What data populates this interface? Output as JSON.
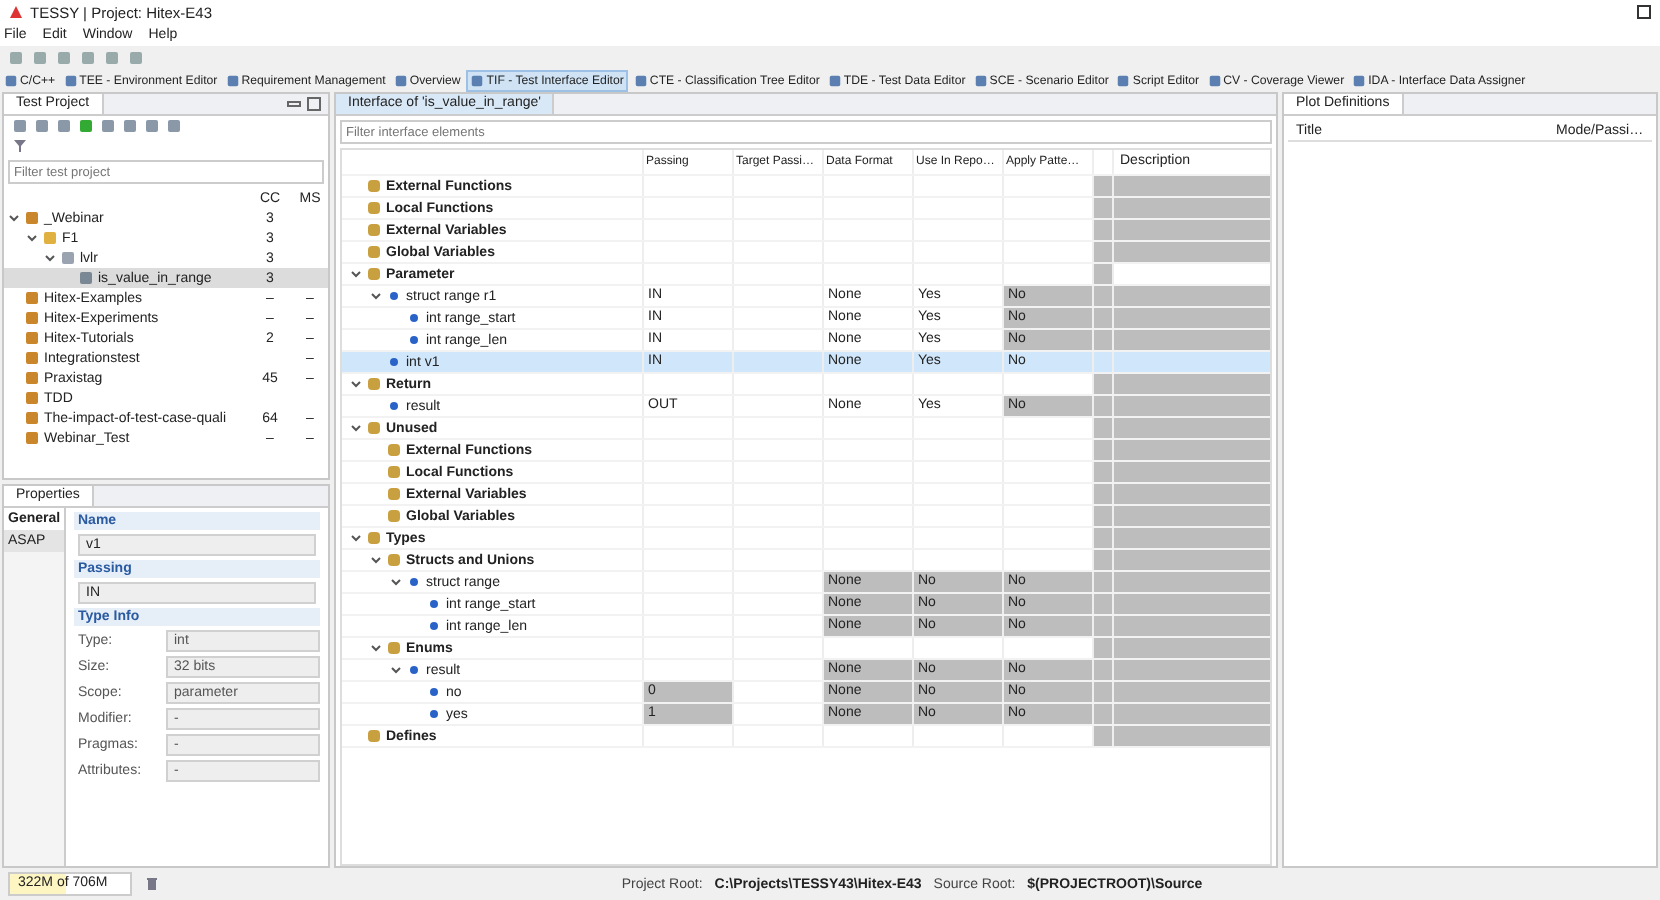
{
  "window": {
    "title": "TESSY | Project: Hitex-E43"
  },
  "menu": [
    "File",
    "Edit",
    "Window",
    "Help"
  ],
  "perspectives": [
    {
      "label": "C/C++",
      "selected": false
    },
    {
      "label": "TEE - Environment Editor",
      "selected": false
    },
    {
      "label": "Requirement Management",
      "selected": false
    },
    {
      "label": "Overview",
      "selected": false
    },
    {
      "label": "TIF - Test Interface Editor",
      "selected": true
    },
    {
      "label": "CTE - Classification Tree Editor",
      "selected": false
    },
    {
      "label": "TDE - Test Data Editor",
      "selected": false
    },
    {
      "label": "SCE - Scenario Editor",
      "selected": false
    },
    {
      "label": "Script Editor",
      "selected": false
    },
    {
      "label": "CV - Coverage Viewer",
      "selected": false
    },
    {
      "label": "IDA - Interface Data Assigner",
      "selected": false
    }
  ],
  "test_project": {
    "title": "Test Project",
    "filter_placeholder": "Filter test project",
    "columns": [
      "CC",
      "MS"
    ],
    "items": [
      {
        "label": "_Webinar",
        "kind": "project",
        "cc": "3",
        "selected": false,
        "expanded": true,
        "children": [
          {
            "label": "F1",
            "kind": "folder",
            "cc": "3",
            "selected": false,
            "expanded": true,
            "children": [
              {
                "label": "lvlr",
                "kind": "module",
                "cc": "3",
                "selected": false,
                "expanded": true,
                "children": [
                  {
                    "label": "is_value_in_range",
                    "kind": "test_object",
                    "cc": "3",
                    "selected": true
                  }
                ]
              }
            ]
          }
        ]
      },
      {
        "label": "Hitex-Examples",
        "kind": "project",
        "cc": "–",
        "ms": "–",
        "selected": false
      },
      {
        "label": "Hitex-Experiments",
        "kind": "project",
        "cc": "–",
        "ms": "–",
        "selected": false
      },
      {
        "label": "Hitex-Tutorials",
        "kind": "project",
        "cc": "2",
        "ms": "–",
        "selected": false
      },
      {
        "label": "Integrationstest",
        "kind": "project",
        "ms": "–",
        "selected": false
      },
      {
        "label": "Praxistag",
        "kind": "project",
        "cc": "45",
        "ms": "–",
        "selected": false
      },
      {
        "label": "TDD",
        "kind": "project",
        "selected": false
      },
      {
        "label": "The-impact-of-test-case-quali",
        "kind": "project",
        "cc": "64",
        "ms": "–",
        "selected": false
      },
      {
        "label": "Webinar_Test",
        "kind": "project",
        "cc": "–",
        "ms": "–",
        "selected": false
      }
    ]
  },
  "properties": {
    "title": "Properties",
    "tabs": [
      {
        "label": "General",
        "selected": true
      },
      {
        "label": "ASAP",
        "selected": false
      }
    ],
    "name": {
      "heading": "Name",
      "value": "v1"
    },
    "passing": {
      "heading": "Passing",
      "value": "IN"
    },
    "type_info": {
      "heading": "Type Info",
      "fields": [
        {
          "label": "Type:",
          "value": "int"
        },
        {
          "label": "Size:",
          "value": "32 bits"
        },
        {
          "label": "Scope:",
          "value": "parameter"
        },
        {
          "label": "Modifier:",
          "value": "-"
        },
        {
          "label": "Pragmas:",
          "value": "-"
        },
        {
          "label": "Attributes:",
          "value": "-"
        }
      ]
    }
  },
  "interface": {
    "title": "Interface of 'is_value_in_range'",
    "filter_placeholder": "Filter interface elements",
    "columns": [
      "Passing",
      "Target Passi…",
      "Data Format",
      "Use In Repo…",
      "Apply Patte…",
      "Description"
    ],
    "rows": [
      {
        "label": "External Functions",
        "kind": "category",
        "selected": false,
        "cells": [
          {
            "greyed": false
          },
          {
            "greyed": false
          },
          {
            "greyed": false
          },
          {
            "greyed": false
          },
          {
            "greyed": false
          },
          {
            "greyed": true
          },
          {
            "greyed": true
          }
        ]
      },
      {
        "label": "Local Functions",
        "kind": "category",
        "selected": false,
        "cells": [
          {
            "greyed": false
          },
          {
            "greyed": false
          },
          {
            "greyed": false
          },
          {
            "greyed": false
          },
          {
            "greyed": false
          },
          {
            "greyed": true
          },
          {
            "greyed": true
          }
        ]
      },
      {
        "label": "External Variables",
        "kind": "category",
        "selected": false,
        "cells": [
          {
            "greyed": false
          },
          {
            "greyed": false
          },
          {
            "greyed": false
          },
          {
            "greyed": false
          },
          {
            "greyed": false
          },
          {
            "greyed": true
          },
          {
            "greyed": true
          }
        ]
      },
      {
        "label": "Global Variables",
        "kind": "category",
        "selected": false,
        "cells": [
          {
            "greyed": false
          },
          {
            "greyed": false
          },
          {
            "greyed": false
          },
          {
            "greyed": false
          },
          {
            "greyed": false
          },
          {
            "greyed": true
          },
          {
            "greyed": true
          }
        ]
      },
      {
        "label": "Parameter",
        "kind": "category",
        "selected": false,
        "expanded": true,
        "cells": [
          {
            "greyed": false
          },
          {
            "greyed": false
          },
          {
            "greyed": false
          },
          {
            "greyed": false
          },
          {
            "greyed": false
          },
          {
            "greyed": true
          },
          {
            "greyed": false
          }
        ],
        "children": [
          {
            "label": "struct range r1",
            "kind": "item",
            "selected": false,
            "expanded": true,
            "cells": [
              {
                "text": "IN",
                "greyed": false
              },
              {
                "greyed": false
              },
              {
                "text": "None",
                "greyed": false
              },
              {
                "text": "Yes",
                "greyed": false
              },
              {
                "text": "No",
                "greyed": true
              },
              {
                "greyed": true
              },
              {
                "greyed": true
              }
            ],
            "children": [
              {
                "label": "int range_start",
                "kind": "item",
                "selected": false,
                "cells": [
                  {
                    "text": "IN",
                    "greyed": false
                  },
                  {
                    "greyed": false
                  },
                  {
                    "text": "None",
                    "greyed": false
                  },
                  {
                    "text": "Yes",
                    "greyed": false
                  },
                  {
                    "text": "No",
                    "greyed": true
                  },
                  {
                    "greyed": true
                  },
                  {
                    "greyed": true
                  }
                ]
              },
              {
                "label": "int range_len",
                "kind": "item",
                "selected": false,
                "cells": [
                  {
                    "text": "IN",
                    "greyed": false
                  },
                  {
                    "greyed": false
                  },
                  {
                    "text": "None",
                    "greyed": false
                  },
                  {
                    "text": "Yes",
                    "greyed": false
                  },
                  {
                    "text": "No",
                    "greyed": true
                  },
                  {
                    "greyed": true
                  },
                  {
                    "greyed": true
                  }
                ]
              }
            ]
          },
          {
            "label": "int v1",
            "kind": "item",
            "selected": true,
            "cells": [
              {
                "text": "IN",
                "greyed": false
              },
              {
                "greyed": false
              },
              {
                "text": "None",
                "greyed": false
              },
              {
                "text": "Yes",
                "greyed": false
              },
              {
                "text": "No",
                "greyed": false
              },
              {
                "greyed": false
              },
              {
                "greyed": false
              }
            ]
          }
        ]
      },
      {
        "label": "Return",
        "kind": "category",
        "selected": false,
        "expanded": true,
        "cells": [
          {
            "greyed": false
          },
          {
            "greyed": false
          },
          {
            "greyed": false
          },
          {
            "greyed": false
          },
          {
            "greyed": false
          },
          {
            "greyed": true
          },
          {
            "greyed": true
          }
        ],
        "children": [
          {
            "label": "result",
            "kind": "item",
            "selected": false,
            "cells": [
              {
                "text": "OUT",
                "greyed": false
              },
              {
                "greyed": false
              },
              {
                "text": "None",
                "greyed": false
              },
              {
                "text": "Yes",
                "greyed": false
              },
              {
                "text": "No",
                "greyed": true
              },
              {
                "greyed": true
              },
              {
                "greyed": true
              }
            ]
          }
        ]
      },
      {
        "label": "Unused",
        "kind": "category",
        "selected": false,
        "expanded": true,
        "cells": [
          {
            "greyed": false
          },
          {
            "greyed": false
          },
          {
            "greyed": false
          },
          {
            "greyed": false
          },
          {
            "greyed": false
          },
          {
            "greyed": true
          },
          {
            "greyed": true
          }
        ],
        "children": [
          {
            "label": "External Functions",
            "kind": "category",
            "selected": false,
            "cells": [
              {
                "greyed": false
              },
              {
                "greyed": false
              },
              {
                "greyed": false
              },
              {
                "greyed": false
              },
              {
                "greyed": false
              },
              {
                "greyed": true
              },
              {
                "greyed": true
              }
            ]
          },
          {
            "label": "Local Functions",
            "kind": "category",
            "selected": false,
            "cells": [
              {
                "greyed": false
              },
              {
                "greyed": false
              },
              {
                "greyed": false
              },
              {
                "greyed": false
              },
              {
                "greyed": false
              },
              {
                "greyed": true
              },
              {
                "greyed": true
              }
            ]
          },
          {
            "label": "External Variables",
            "kind": "category",
            "selected": false,
            "cells": [
              {
                "greyed": false
              },
              {
                "greyed": false
              },
              {
                "greyed": false
              },
              {
                "greyed": false
              },
              {
                "greyed": false
              },
              {
                "greyed": true
              },
              {
                "greyed": true
              }
            ]
          },
          {
            "label": "Global Variables",
            "kind": "category",
            "selected": false,
            "cells": [
              {
                "greyed": false
              },
              {
                "greyed": false
              },
              {
                "greyed": false
              },
              {
                "greyed": false
              },
              {
                "greyed": false
              },
              {
                "greyed": true
              },
              {
                "greyed": true
              }
            ]
          }
        ]
      },
      {
        "label": "Types",
        "kind": "category",
        "selected": false,
        "expanded": true,
        "cells": [
          {
            "greyed": false
          },
          {
            "greyed": false
          },
          {
            "greyed": false
          },
          {
            "greyed": false
          },
          {
            "greyed": false
          },
          {
            "greyed": true
          },
          {
            "greyed": true
          }
        ],
        "children": [
          {
            "label": "Structs and Unions",
            "kind": "category",
            "selected": false,
            "expanded": true,
            "cells": [
              {
                "greyed": false
              },
              {
                "greyed": false
              },
              {
                "greyed": false
              },
              {
                "greyed": false
              },
              {
                "greyed": false
              },
              {
                "greyed": true
              },
              {
                "greyed": true
              }
            ],
            "children": [
              {
                "label": "struct range",
                "kind": "item",
                "selected": false,
                "expanded": true,
                "cells": [
                  {
                    "greyed": false
                  },
                  {
                    "greyed": false
                  },
                  {
                    "text": "None",
                    "greyed": true
                  },
                  {
                    "text": "No",
                    "greyed": true
                  },
                  {
                    "text": "No",
                    "greyed": true
                  },
                  {
                    "greyed": true
                  },
                  {
                    "greyed": true
                  }
                ],
                "children": [
                  {
                    "label": "int range_start",
                    "kind": "item",
                    "selected": false,
                    "cells": [
                      {
                        "greyed": false
                      },
                      {
                        "greyed": false
                      },
                      {
                        "text": "None",
                        "greyed": true
                      },
                      {
                        "text": "No",
                        "greyed": true
                      },
                      {
                        "text": "No",
                        "greyed": true
                      },
                      {
                        "greyed": true
                      },
                      {
                        "greyed": true
                      }
                    ]
                  },
                  {
                    "label": "int range_len",
                    "kind": "item",
                    "selected": false,
                    "cells": [
                      {
                        "greyed": false
                      },
                      {
                        "greyed": false
                      },
                      {
                        "text": "None",
                        "greyed": true
                      },
                      {
                        "text": "No",
                        "greyed": true
                      },
                      {
                        "text": "No",
                        "greyed": true
                      },
                      {
                        "greyed": true
                      },
                      {
                        "greyed": true
                      }
                    ]
                  }
                ]
              }
            ]
          },
          {
            "label": "Enums",
            "kind": "category",
            "selected": false,
            "expanded": true,
            "cells": [
              {
                "greyed": false
              },
              {
                "greyed": false
              },
              {
                "greyed": false
              },
              {
                "greyed": false
              },
              {
                "greyed": false
              },
              {
                "greyed": true
              },
              {
                "greyed": true
              }
            ],
            "children": [
              {
                "label": "result",
                "kind": "item",
                "selected": false,
                "expanded": true,
                "cells": [
                  {
                    "greyed": false
                  },
                  {
                    "greyed": false
                  },
                  {
                    "text": "None",
                    "greyed": true
                  },
                  {
                    "text": "No",
                    "greyed": true
                  },
                  {
                    "text": "No",
                    "greyed": true
                  },
                  {
                    "greyed": true
                  },
                  {
                    "greyed": true
                  }
                ],
                "children": [
                  {
                    "label": "no",
                    "kind": "item",
                    "selected": false,
                    "cells": [
                      {
                        "text": "0",
                        "greyed": true
                      },
                      {
                        "greyed": false
                      },
                      {
                        "text": "None",
                        "greyed": true
                      },
                      {
                        "text": "No",
                        "greyed": true
                      },
                      {
                        "text": "No",
                        "greyed": true
                      },
                      {
                        "greyed": true
                      },
                      {
                        "greyed": true
                      }
                    ]
                  },
                  {
                    "label": "yes",
                    "kind": "item",
                    "selected": false,
                    "cells": [
                      {
                        "text": "1",
                        "greyed": true
                      },
                      {
                        "greyed": false
                      },
                      {
                        "text": "None",
                        "greyed": true
                      },
                      {
                        "text": "No",
                        "greyed": true
                      },
                      {
                        "text": "No",
                        "greyed": true
                      },
                      {
                        "greyed": true
                      },
                      {
                        "greyed": true
                      }
                    ]
                  }
                ]
              }
            ]
          }
        ]
      },
      {
        "label": "Defines",
        "kind": "category",
        "selected": false,
        "cells": [
          {
            "greyed": false
          },
          {
            "greyed": false
          },
          {
            "greyed": false
          },
          {
            "greyed": false
          },
          {
            "greyed": false
          },
          {
            "greyed": true
          },
          {
            "greyed": true
          }
        ]
      }
    ]
  },
  "plot_definitions": {
    "title": "Plot Definitions",
    "columns": [
      "Title",
      "Mode/Passi…"
    ]
  },
  "status_bar": {
    "memory": {
      "used": "322M",
      "total": "of 706M",
      "level": 0.46
    },
    "project_root": {
      "label": "Project Root:",
      "value": "C:\\Projects\\TESSY43\\Hitex-E43"
    },
    "source_root": {
      "label": "Source Root:",
      "value": "$(PROJECTROOT)\\Source"
    }
  }
}
